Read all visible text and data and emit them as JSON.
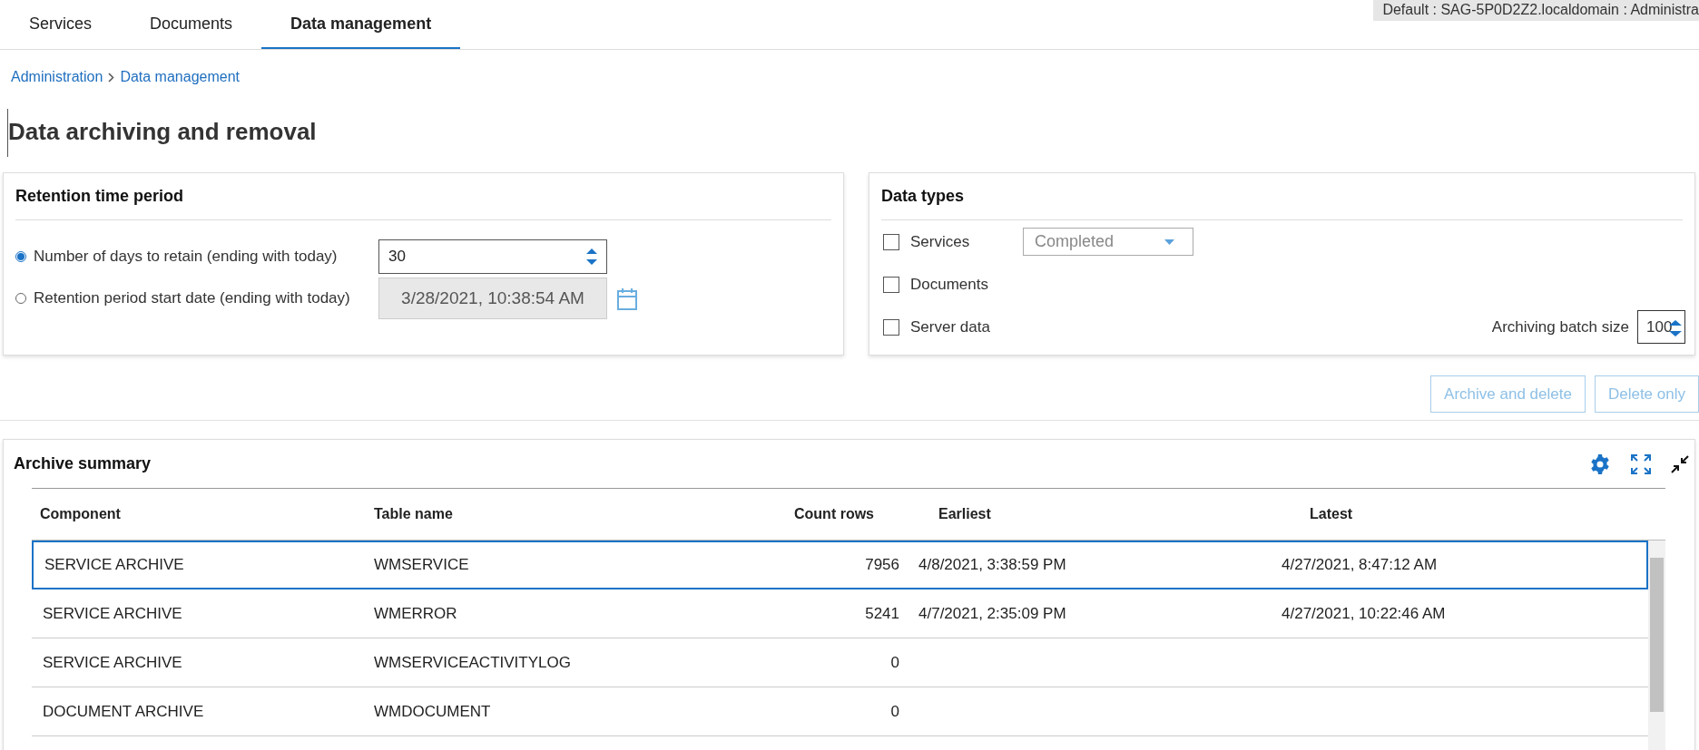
{
  "tabs": [
    {
      "label": "Services",
      "selected": false
    },
    {
      "label": "Documents",
      "selected": false
    },
    {
      "label": "Data management",
      "selected": true
    }
  ],
  "session_label": "Default : SAG-5P0D2Z2.localdomain : Administra",
  "breadcrumb": [
    {
      "label": "Administration"
    },
    {
      "label": "Data management"
    }
  ],
  "title": "Data archiving and removal",
  "retention": {
    "title": "Retention time period",
    "options": [
      {
        "label": "Number of days to retain (ending with today)",
        "selected": true,
        "kind": "number",
        "value": "30",
        "disabled": false
      },
      {
        "label": "Retention period start date (ending with today)",
        "selected": false,
        "kind": "date",
        "value": "3/28/2021, 10:38:54 AM",
        "disabled": true
      }
    ]
  },
  "data_types": {
    "title": "Data types",
    "items": [
      {
        "label": "Services",
        "checked": false,
        "status": {
          "value": "Completed",
          "disabled": true
        }
      },
      {
        "label": "Documents",
        "checked": false
      },
      {
        "label": "Server data",
        "checked": false
      }
    ],
    "batch_size": {
      "label": "Archiving batch size",
      "value": "100"
    }
  },
  "actions": [
    {
      "label": "Archive and delete",
      "disabled": true
    },
    {
      "label": "Delete only",
      "disabled": true
    }
  ],
  "archive_summary": {
    "title": "Archive summary",
    "columns": [
      "Component",
      "Table name",
      "Count rows",
      "Earliest",
      "Latest"
    ],
    "rows": [
      {
        "selected": true,
        "cells": [
          "SERVICE ARCHIVE",
          "WMSERVICE",
          "7956",
          "4/8/2021, 3:38:59 PM",
          "4/27/2021, 8:47:12 AM"
        ]
      },
      {
        "selected": false,
        "cells": [
          "SERVICE ARCHIVE",
          "WMERROR",
          "5241",
          "4/7/2021, 2:35:09 PM",
          "4/27/2021, 10:22:46 AM"
        ]
      },
      {
        "selected": false,
        "cells": [
          "SERVICE ARCHIVE",
          "WMSERVICEACTIVITYLOG",
          "0",
          "",
          ""
        ]
      },
      {
        "selected": false,
        "cells": [
          "DOCUMENT ARCHIVE",
          "WMDOCUMENT",
          "0",
          "",
          ""
        ]
      }
    ]
  }
}
